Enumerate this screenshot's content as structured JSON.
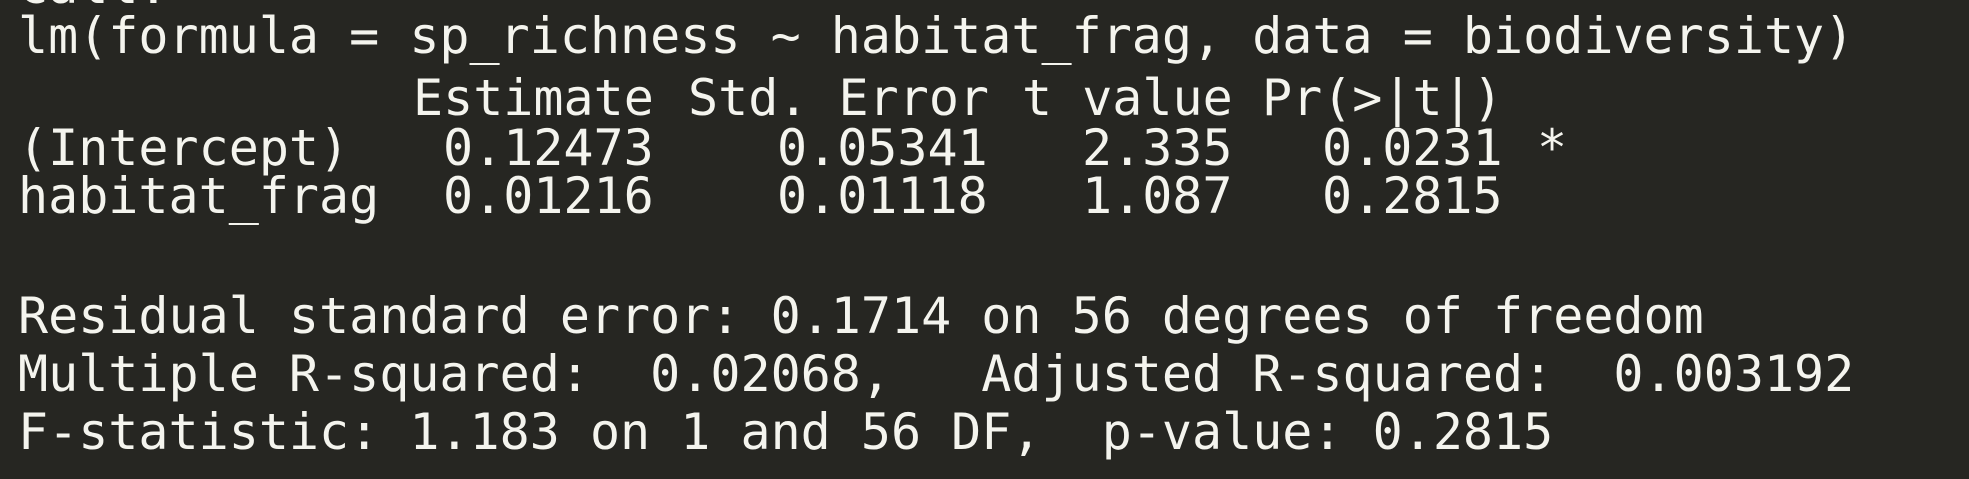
{
  "console": {
    "partial_top_text": "Call:",
    "call_line": "lm(formula = sp_richness ~ habitat_frag, data = biodiversity)",
    "coef_table": {
      "headers": [
        "Estimate",
        "Std. Error",
        "t value",
        "Pr(>|t|)"
      ],
      "rows": [
        {
          "name": "(Intercept)",
          "estimate": "0.12473",
          "std_error": "0.05341",
          "t_value": "2.335",
          "p_value": "0.0231",
          "signif": "*"
        },
        {
          "name": "habitat_frag",
          "estimate": "0.01216",
          "std_error": "0.01118",
          "t_value": "1.087",
          "p_value": "0.2815",
          "signif": ""
        }
      ]
    },
    "residual_line": "Residual standard error: 0.1714 on 56 degrees of freedom",
    "rsquared_line": "Multiple R-squared:  0.02068,   Adjusted R-squared:  0.003192",
    "fstat_line": "F-statistic: 1.183 on 1 and 56 DF,  p-value: 0.2815"
  },
  "colors": {
    "background": "#262622",
    "text": "#f4f4ee"
  }
}
